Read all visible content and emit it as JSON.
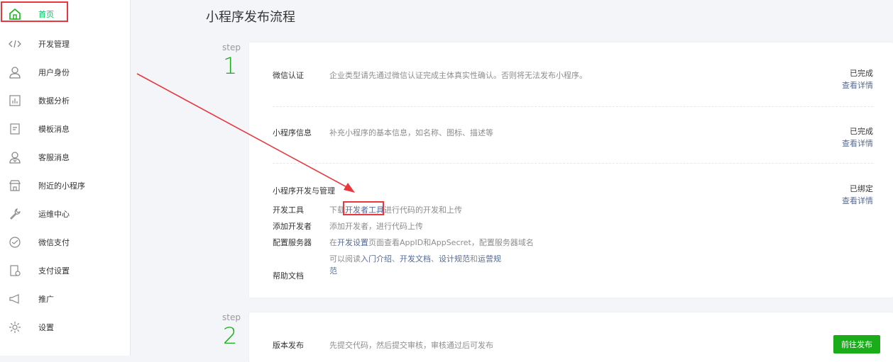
{
  "sidebar": {
    "items": [
      {
        "label": "首页",
        "icon": "home-icon",
        "active": true
      },
      {
        "label": "开发管理",
        "icon": "code-icon"
      },
      {
        "label": "用户身份",
        "icon": "user-icon"
      },
      {
        "label": "数据分析",
        "icon": "chart-icon"
      },
      {
        "label": "模板消息",
        "icon": "document-icon"
      },
      {
        "label": "客服消息",
        "icon": "service-icon"
      },
      {
        "label": "附近的小程序",
        "icon": "store-icon"
      },
      {
        "label": "运维中心",
        "icon": "wrench-icon"
      },
      {
        "label": "微信支付",
        "icon": "pay-icon"
      },
      {
        "label": "支付设置",
        "icon": "pay-settings-icon"
      },
      {
        "label": "推广",
        "icon": "megaphone-icon"
      },
      {
        "label": "设置",
        "icon": "gear-icon"
      }
    ]
  },
  "page": {
    "title": "小程序发布流程"
  },
  "steps": [
    {
      "word": "step",
      "number": "1"
    },
    {
      "word": "step",
      "number": "2"
    }
  ],
  "step1": {
    "rows": [
      {
        "name": "微信认证",
        "desc": "企业类型请先通过微信认证完成主体真实性确认。否则将无法发布小程序。",
        "status": "已完成",
        "link": "查看详情"
      },
      {
        "name": "小程序信息",
        "desc": "补充小程序的基本信息，如名称、图标、描述等",
        "status": "已完成",
        "link": "查看详情"
      }
    ],
    "dev": {
      "title": "小程序开发与管理",
      "status": "已绑定",
      "link": "查看详情",
      "tools_label": "开发工具",
      "tools_pre": "下载",
      "tools_link": "开发者工具",
      "tools_post": "进行代码的开发和上传",
      "add_label": "添加开发者",
      "add_desc": "添加开发者，进行代码上传",
      "server_label": "配置服务器",
      "server_pre": "在",
      "server_link": "开发设置",
      "server_post": "页面查看AppID和AppSecret，配置服务器域名",
      "help_label": "帮助文档",
      "help_pre": "可以阅读",
      "help_link1": "入门介绍",
      "help_sep1": "、",
      "help_link2": "开发文档",
      "help_sep2": "、",
      "help_link3": "设计规范",
      "help_and": "和",
      "help_link4a": "运营规",
      "help_link4b": "范"
    }
  },
  "step2": {
    "name": "版本发布",
    "desc": "先提交代码，然后提交审核，审核通过后可发布",
    "button": "前往发布"
  },
  "colors": {
    "accent": "#1aad19",
    "link": "#576b95",
    "highlight": "#e8383d"
  }
}
